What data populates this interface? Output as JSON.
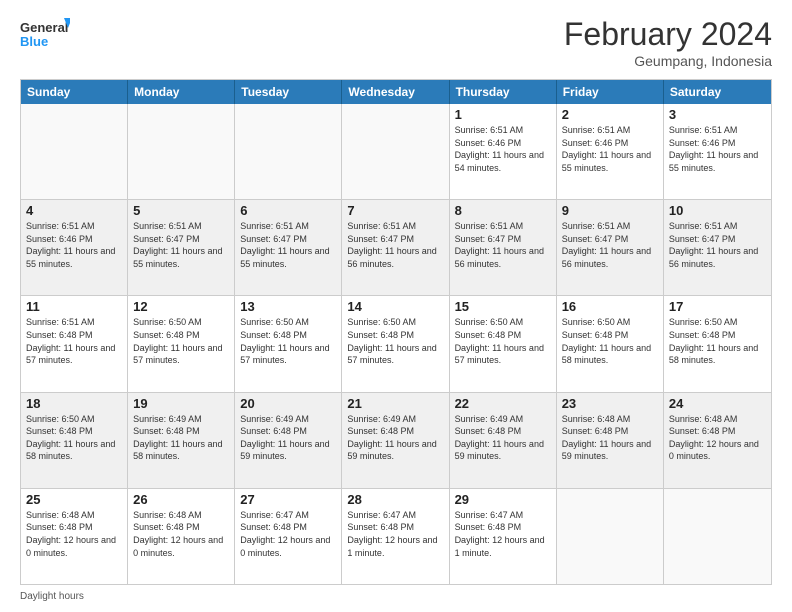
{
  "logo": {
    "line1": "General",
    "line2": "Blue"
  },
  "title": "February 2024",
  "subtitle": "Geumpang, Indonesia",
  "header_days": [
    "Sunday",
    "Monday",
    "Tuesday",
    "Wednesday",
    "Thursday",
    "Friday",
    "Saturday"
  ],
  "weeks": [
    [
      {
        "day": "",
        "info": ""
      },
      {
        "day": "",
        "info": ""
      },
      {
        "day": "",
        "info": ""
      },
      {
        "day": "",
        "info": ""
      },
      {
        "day": "1",
        "info": "Sunrise: 6:51 AM\nSunset: 6:46 PM\nDaylight: 11 hours\nand 54 minutes."
      },
      {
        "day": "2",
        "info": "Sunrise: 6:51 AM\nSunset: 6:46 PM\nDaylight: 11 hours\nand 55 minutes."
      },
      {
        "day": "3",
        "info": "Sunrise: 6:51 AM\nSunset: 6:46 PM\nDaylight: 11 hours\nand 55 minutes."
      }
    ],
    [
      {
        "day": "4",
        "info": "Sunrise: 6:51 AM\nSunset: 6:46 PM\nDaylight: 11 hours\nand 55 minutes."
      },
      {
        "day": "5",
        "info": "Sunrise: 6:51 AM\nSunset: 6:47 PM\nDaylight: 11 hours\nand 55 minutes."
      },
      {
        "day": "6",
        "info": "Sunrise: 6:51 AM\nSunset: 6:47 PM\nDaylight: 11 hours\nand 55 minutes."
      },
      {
        "day": "7",
        "info": "Sunrise: 6:51 AM\nSunset: 6:47 PM\nDaylight: 11 hours\nand 56 minutes."
      },
      {
        "day": "8",
        "info": "Sunrise: 6:51 AM\nSunset: 6:47 PM\nDaylight: 11 hours\nand 56 minutes."
      },
      {
        "day": "9",
        "info": "Sunrise: 6:51 AM\nSunset: 6:47 PM\nDaylight: 11 hours\nand 56 minutes."
      },
      {
        "day": "10",
        "info": "Sunrise: 6:51 AM\nSunset: 6:47 PM\nDaylight: 11 hours\nand 56 minutes."
      }
    ],
    [
      {
        "day": "11",
        "info": "Sunrise: 6:51 AM\nSunset: 6:48 PM\nDaylight: 11 hours\nand 57 minutes."
      },
      {
        "day": "12",
        "info": "Sunrise: 6:50 AM\nSunset: 6:48 PM\nDaylight: 11 hours\nand 57 minutes."
      },
      {
        "day": "13",
        "info": "Sunrise: 6:50 AM\nSunset: 6:48 PM\nDaylight: 11 hours\nand 57 minutes."
      },
      {
        "day": "14",
        "info": "Sunrise: 6:50 AM\nSunset: 6:48 PM\nDaylight: 11 hours\nand 57 minutes."
      },
      {
        "day": "15",
        "info": "Sunrise: 6:50 AM\nSunset: 6:48 PM\nDaylight: 11 hours\nand 57 minutes."
      },
      {
        "day": "16",
        "info": "Sunrise: 6:50 AM\nSunset: 6:48 PM\nDaylight: 11 hours\nand 58 minutes."
      },
      {
        "day": "17",
        "info": "Sunrise: 6:50 AM\nSunset: 6:48 PM\nDaylight: 11 hours\nand 58 minutes."
      }
    ],
    [
      {
        "day": "18",
        "info": "Sunrise: 6:50 AM\nSunset: 6:48 PM\nDaylight: 11 hours\nand 58 minutes."
      },
      {
        "day": "19",
        "info": "Sunrise: 6:49 AM\nSunset: 6:48 PM\nDaylight: 11 hours\nand 58 minutes."
      },
      {
        "day": "20",
        "info": "Sunrise: 6:49 AM\nSunset: 6:48 PM\nDaylight: 11 hours\nand 59 minutes."
      },
      {
        "day": "21",
        "info": "Sunrise: 6:49 AM\nSunset: 6:48 PM\nDaylight: 11 hours\nand 59 minutes."
      },
      {
        "day": "22",
        "info": "Sunrise: 6:49 AM\nSunset: 6:48 PM\nDaylight: 11 hours\nand 59 minutes."
      },
      {
        "day": "23",
        "info": "Sunrise: 6:48 AM\nSunset: 6:48 PM\nDaylight: 11 hours\nand 59 minutes."
      },
      {
        "day": "24",
        "info": "Sunrise: 6:48 AM\nSunset: 6:48 PM\nDaylight: 12 hours\nand 0 minutes."
      }
    ],
    [
      {
        "day": "25",
        "info": "Sunrise: 6:48 AM\nSunset: 6:48 PM\nDaylight: 12 hours\nand 0 minutes."
      },
      {
        "day": "26",
        "info": "Sunrise: 6:48 AM\nSunset: 6:48 PM\nDaylight: 12 hours\nand 0 minutes."
      },
      {
        "day": "27",
        "info": "Sunrise: 6:47 AM\nSunset: 6:48 PM\nDaylight: 12 hours\nand 0 minutes."
      },
      {
        "day": "28",
        "info": "Sunrise: 6:47 AM\nSunset: 6:48 PM\nDaylight: 12 hours\nand 1 minute."
      },
      {
        "day": "29",
        "info": "Sunrise: 6:47 AM\nSunset: 6:48 PM\nDaylight: 12 hours\nand 1 minute."
      },
      {
        "day": "",
        "info": ""
      },
      {
        "day": "",
        "info": ""
      }
    ]
  ],
  "footer": "Daylight hours"
}
